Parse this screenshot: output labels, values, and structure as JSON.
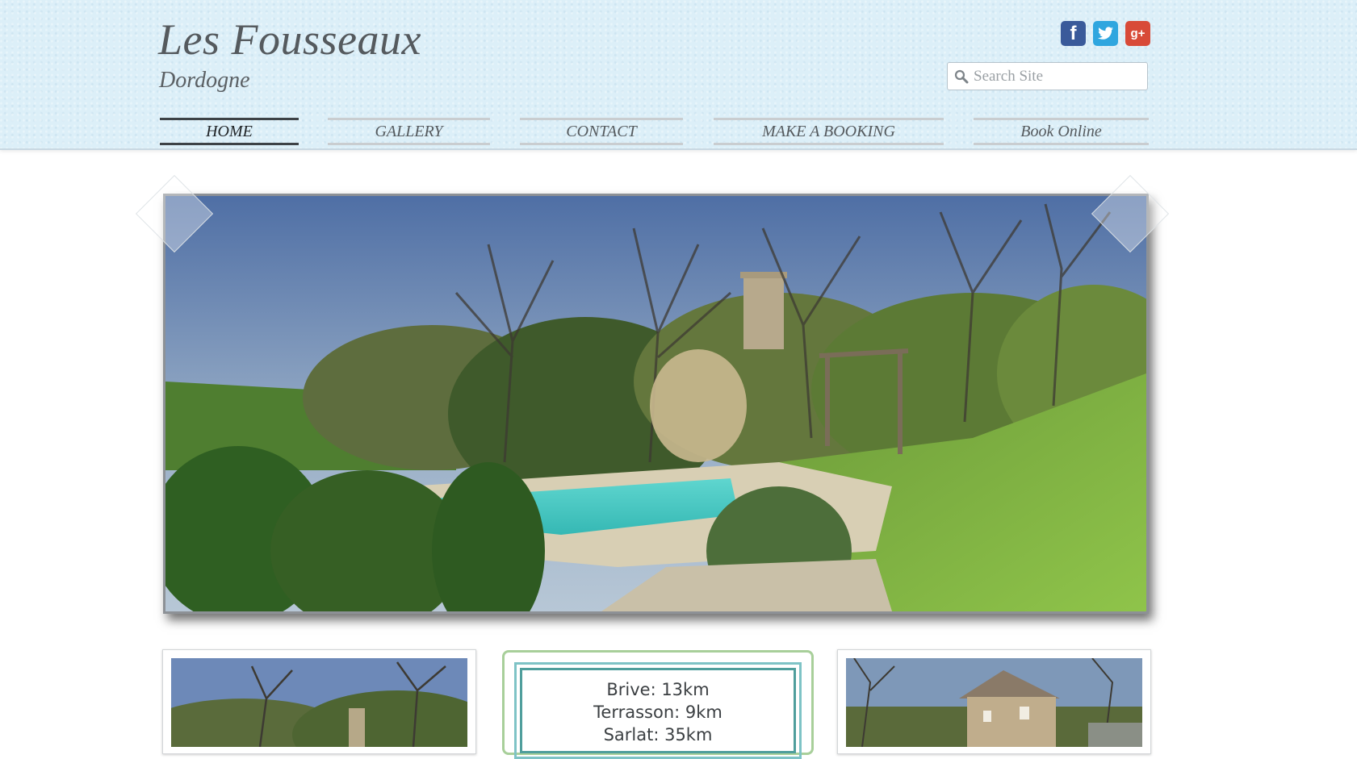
{
  "header": {
    "title": "Les Fousseaux",
    "subtitle": "Dordogne",
    "social": [
      {
        "name": "facebook-icon",
        "glyph": "f",
        "color": "#3a5a9a"
      },
      {
        "name": "twitter-icon",
        "glyph": "t",
        "color": "#2fa6df"
      },
      {
        "name": "google-plus-icon",
        "glyph": "g+",
        "color": "#d84a38"
      }
    ],
    "search": {
      "placeholder": "Search Site",
      "value": ""
    }
  },
  "nav": {
    "items": [
      {
        "label": "HOME",
        "active": true
      },
      {
        "label": "GALLERY",
        "active": false
      },
      {
        "label": "CONTACT",
        "active": false
      },
      {
        "label": "MAKE A BOOKING",
        "active": false
      },
      {
        "label": "Book Online",
        "active": false
      }
    ]
  },
  "slider": {
    "prev_icon": "chevron-left-icon",
    "next_icon": "chevron-right-icon"
  },
  "distances": {
    "lines": [
      "Brive:  13km",
      "Terrasson:  9km",
      "Sarlat:  35km"
    ]
  },
  "colors": {
    "header_bg": "#dceff8",
    "nav_active": "#3d4246",
    "nav_inactive": "#c9cdd0",
    "card_green": "#a8cf9a",
    "card_teal": "#4f9e9c"
  }
}
